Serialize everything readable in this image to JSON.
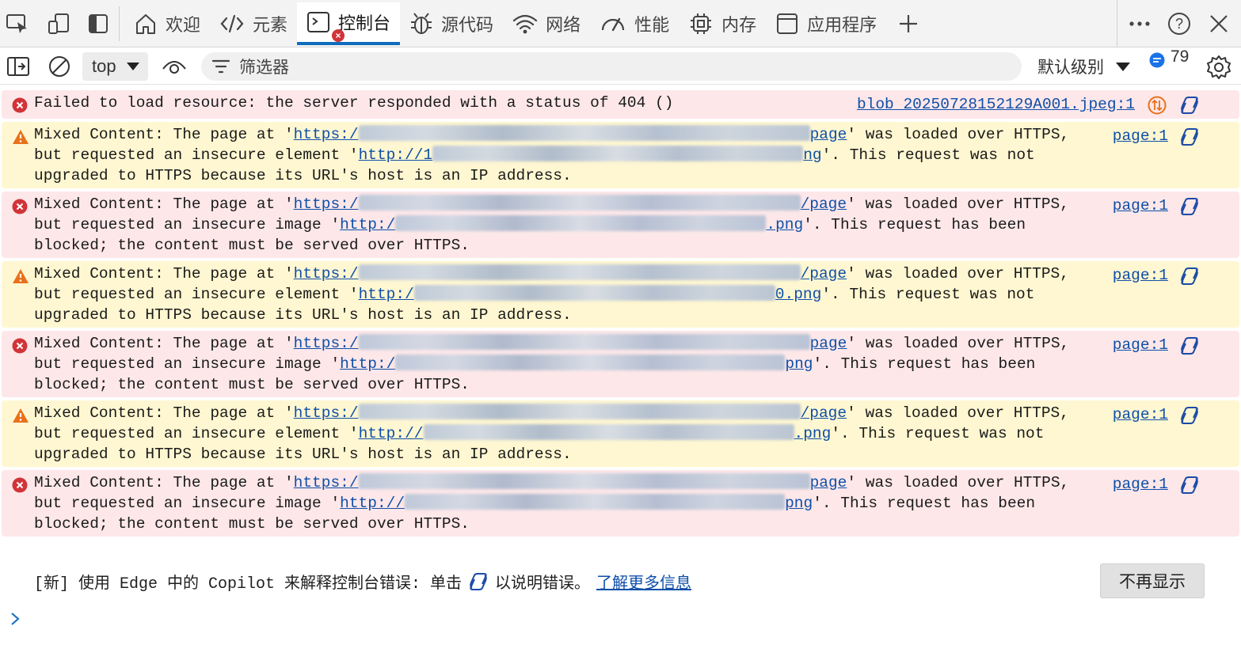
{
  "tabs": [
    {
      "label": "欢迎",
      "icon": "home-icon"
    },
    {
      "label": "元素",
      "icon": "code-icon"
    },
    {
      "label": "控制台",
      "icon": "console-icon",
      "active": true
    },
    {
      "label": "源代码",
      "icon": "bug-icon"
    },
    {
      "label": "网络",
      "icon": "wifi-icon"
    },
    {
      "label": "性能",
      "icon": "gauge-icon"
    },
    {
      "label": "内存",
      "icon": "chip-icon"
    },
    {
      "label": "应用程序",
      "icon": "app-icon"
    }
  ],
  "toolbar": {
    "context": "top",
    "filter_placeholder": "筛选器",
    "level": "默认级别",
    "message_count": "79"
  },
  "messages": [
    {
      "level": "error",
      "text_a": "Failed to load resource: the server responded with a status of 404 ()",
      "source": "blob_20250728152129A001.jpeg:1"
    },
    {
      "level": "warning",
      "pre": "Mixed Content: The page at '",
      "url1_start": "https:/",
      "url1_end": "page",
      "mid": "' was loaded over HTTPS,\nbut requested an insecure element '",
      "url2_start": "http://1",
      "url2_end": "ng",
      "post": "'. This request was not\nupgraded to HTTPS because its URL's host is an IP address.",
      "source": "page:1"
    },
    {
      "level": "error",
      "pre": "Mixed Content: The page at '",
      "url1_start": "https:/",
      "url1_end": "/page",
      "mid": "' was loaded over HTTPS,\nbut requested an insecure image '",
      "url2_start": "http:/",
      "url2_end": ".png",
      "post": "'. This request has been\nblocked; the content must be served over HTTPS.",
      "source": "page:1"
    },
    {
      "level": "warning",
      "pre": "Mixed Content: The page at '",
      "url1_start": "https:/",
      "url1_end": "/page",
      "mid": "' was loaded over HTTPS,\nbut requested an insecure element '",
      "url2_start": "http:/",
      "url2_end": "0.png",
      "post": "'. This request was not\nupgraded to HTTPS because its URL's host is an IP address.",
      "source": "page:1"
    },
    {
      "level": "error",
      "pre": "Mixed Content: The page at '",
      "url1_start": "https:/",
      "url1_end": "page",
      "mid": "' was loaded over HTTPS,\nbut requested an insecure image '",
      "url2_start": "http:/",
      "url2_end": "png",
      "post": "'. This request has been\nblocked; the content must be served over HTTPS.",
      "source": "page:1"
    },
    {
      "level": "warning",
      "pre": "Mixed Content: The page at '",
      "url1_start": "https:/",
      "url1_end": "/page",
      "mid": "' was loaded over HTTPS,\nbut requested an insecure element '",
      "url2_start": "http://",
      "url2_end": ".png",
      "post": "'. This request was not\nupgraded to HTTPS because its URL's host is an IP address.",
      "source": "page:1"
    },
    {
      "level": "error",
      "pre": "Mixed Content: The page at '",
      "url1_start": "https:/",
      "url1_end": "page",
      "mid": "' was loaded over HTTPS,\nbut requested an insecure image '",
      "url2_start": "http://",
      "url2_end": "png",
      "post": "'. This request has been\nblocked; the content must be served over HTTPS.",
      "source": "page:1"
    }
  ],
  "copilot_tip": {
    "text_before": "[新] 使用 Edge 中的 Copilot 来解释控制台错误: 单击",
    "text_after": "以说明错误。",
    "link": "了解更多信息",
    "dismiss": "不再显示"
  },
  "colors": {
    "error_bg": "#fde7e9",
    "warning_bg": "#fff7d1",
    "accent": "#0f6cbd",
    "link": "#0f4fa8"
  }
}
